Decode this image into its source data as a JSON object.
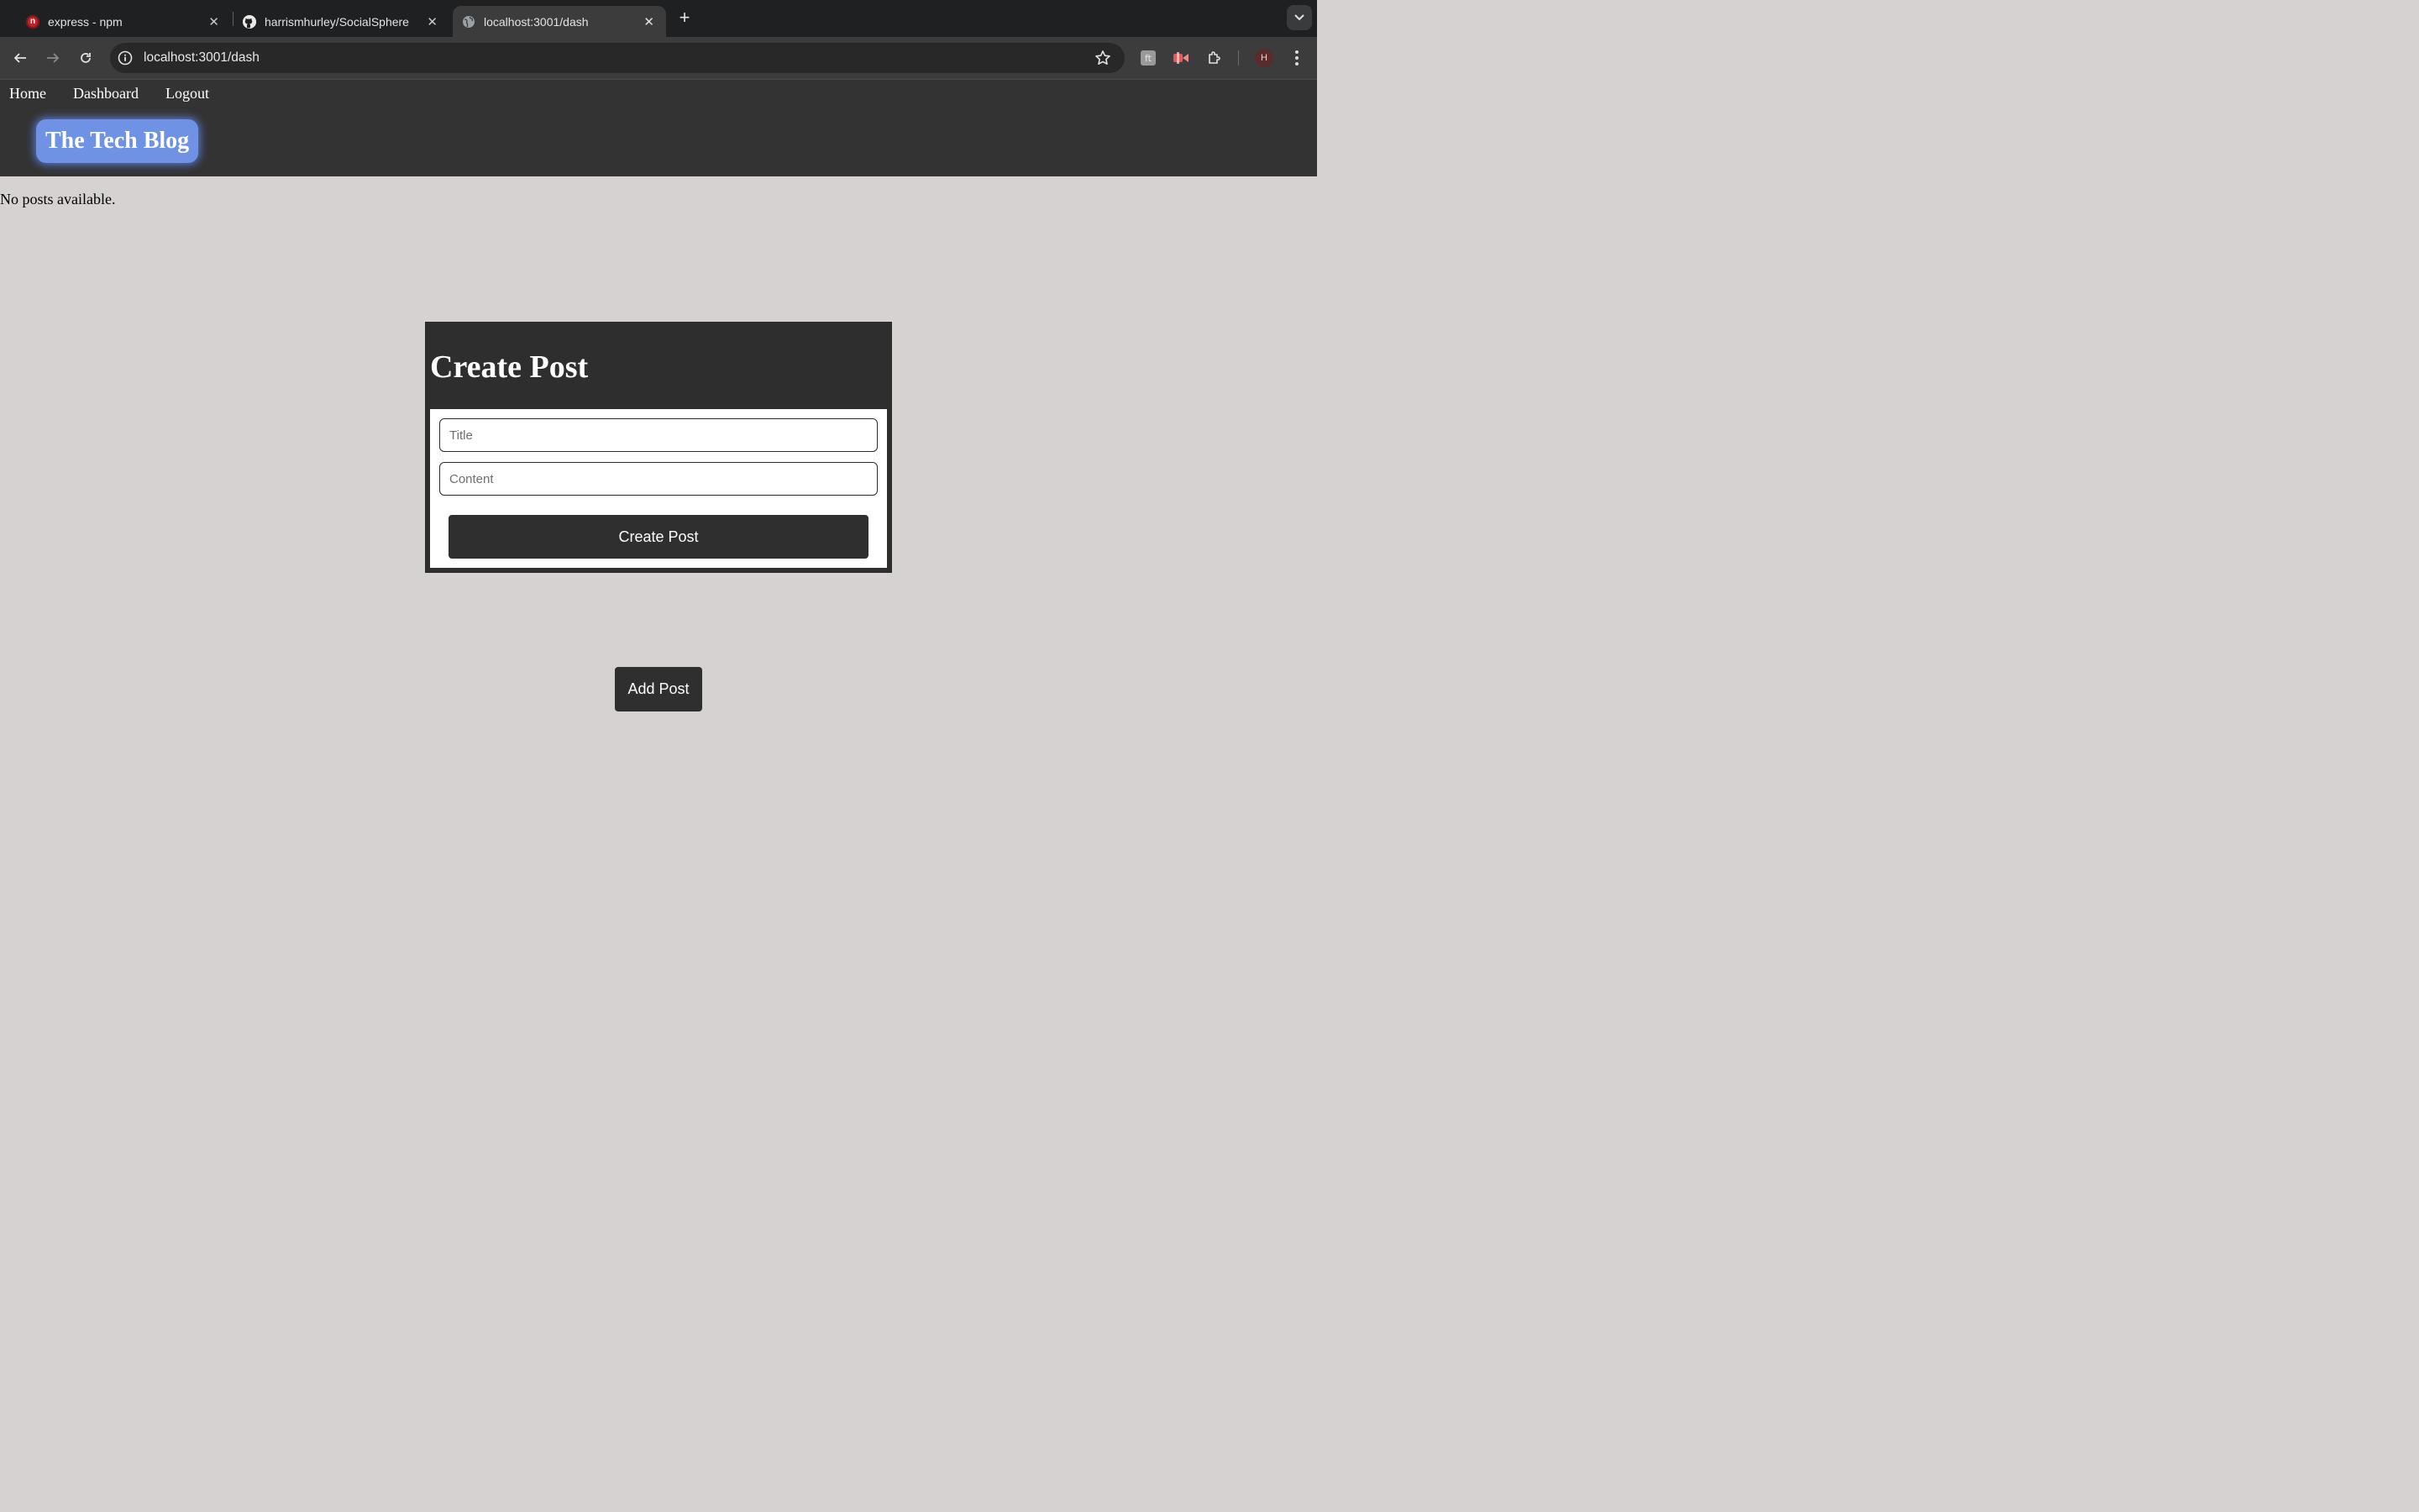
{
  "browser": {
    "tabs": [
      {
        "title": "express - npm",
        "favicon": "npm-icon",
        "active": false
      },
      {
        "title": "harrismhurley/SocialSphere",
        "favicon": "github-icon",
        "active": false
      },
      {
        "title": "localhost:3001/dash",
        "favicon": "globe-icon",
        "active": true
      }
    ],
    "url": "localhost:3001/dash",
    "profile_initial": "H"
  },
  "site": {
    "nav": {
      "home": "Home",
      "dashboard": "Dashboard",
      "logout": "Logout"
    },
    "brand": "The Tech Blog",
    "brand_color": "#6f92e4",
    "header_color": "#333333"
  },
  "main": {
    "empty_message": "No posts available.",
    "create_form": {
      "heading": "Create Post",
      "title_placeholder": "Title",
      "content_placeholder": "Content",
      "submit_label": "Create Post"
    },
    "add_post_label": "Add Post"
  }
}
